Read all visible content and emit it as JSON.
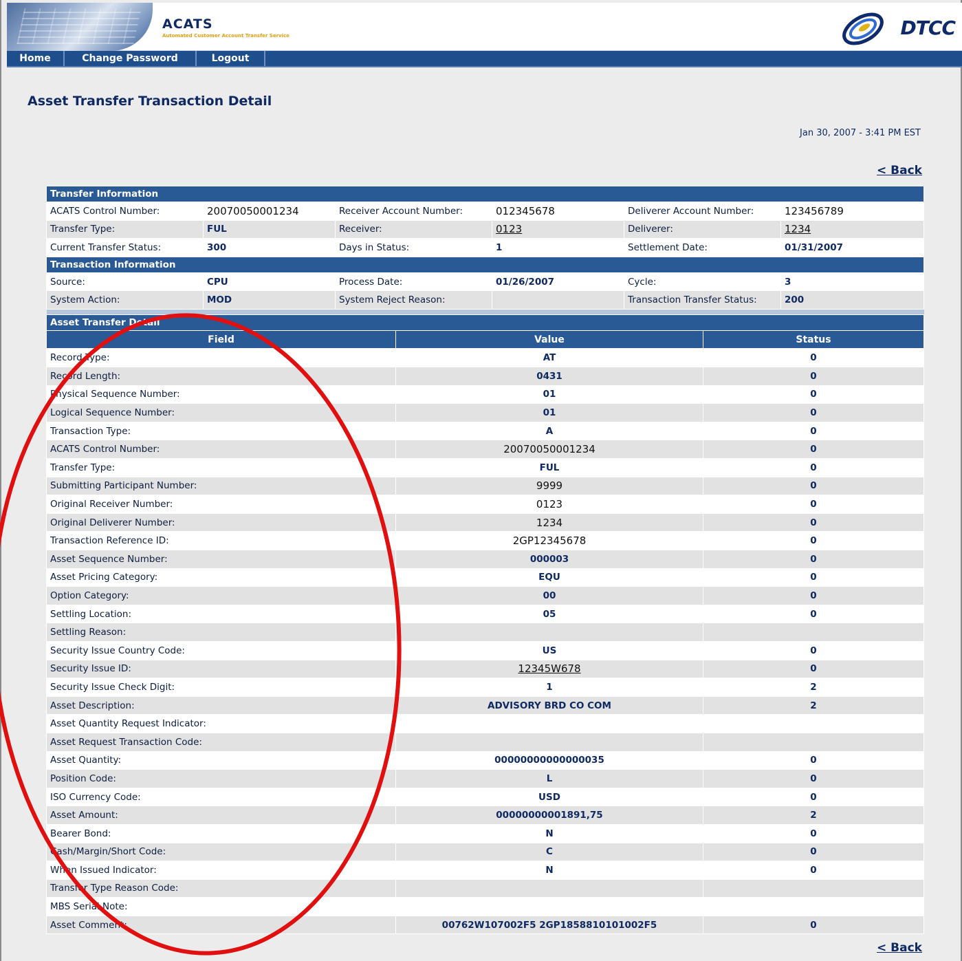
{
  "app": {
    "title": "ACATS",
    "subtitle": "Automated Customer Account Transfer Service",
    "brand": "DTCC"
  },
  "nav": {
    "home": "Home",
    "change_password": "Change Password",
    "logout": "Logout"
  },
  "page": {
    "title": "Asset Transfer Transaction Detail",
    "timestamp": "Jan 30, 2007 - 3:41 PM EST",
    "back_label": "< Back"
  },
  "transfer_info": {
    "heading": "Transfer Information",
    "rows": [
      [
        {
          "label": "ACATS Control Number:",
          "value": "20070050001234"
        },
        {
          "label": "Receiver Account Number:",
          "value": "012345678"
        },
        {
          "label": "Deliverer Account Number:",
          "value": "123456789"
        }
      ],
      [
        {
          "label": "Transfer Type:",
          "value": "FUL"
        },
        {
          "label": "Receiver:",
          "value": "0123"
        },
        {
          "label": "Deliverer:",
          "value": "1234"
        }
      ],
      [
        {
          "label": "Current Transfer Status:",
          "value": "300"
        },
        {
          "label": "Days in Status:",
          "value": "1"
        },
        {
          "label": "Settlement Date:",
          "value": "01/31/2007"
        }
      ]
    ]
  },
  "transaction_info": {
    "heading": "Transaction Information",
    "rows": [
      [
        {
          "label": "Source:",
          "value": "CPU"
        },
        {
          "label": "Process Date:",
          "value": "01/26/2007"
        },
        {
          "label": "Cycle:",
          "value": "3"
        }
      ],
      [
        {
          "label": "System Action:",
          "value": "MOD"
        },
        {
          "label": "System Reject Reason:",
          "value": ""
        },
        {
          "label": "Transaction Transfer Status:",
          "value": "200"
        }
      ]
    ]
  },
  "asset_detail": {
    "heading": "Asset Transfer Detail",
    "columns": [
      "Field",
      "Value",
      "Status"
    ],
    "rows": [
      {
        "field": "Record Type:",
        "value": "AT",
        "status": "0"
      },
      {
        "field": "Record Length:",
        "value": "0431",
        "status": "0"
      },
      {
        "field": "Physical Sequence Number:",
        "value": "01",
        "status": "0"
      },
      {
        "field": "Logical Sequence Number:",
        "value": "01",
        "status": "0"
      },
      {
        "field": "Transaction Type:",
        "value": "A",
        "status": "0"
      },
      {
        "field": "ACATS Control Number:",
        "value": "20070050001234",
        "status": "0"
      },
      {
        "field": "Transfer Type:",
        "value": "FUL",
        "status": "0"
      },
      {
        "field": "Submitting Participant Number:",
        "value": "9999",
        "status": "0"
      },
      {
        "field": "Original Receiver Number:",
        "value": "0123",
        "status": "0"
      },
      {
        "field": "Original Deliverer Number:",
        "value": "1234",
        "status": "0"
      },
      {
        "field": "Transaction Reference ID:",
        "value": "2GP12345678",
        "status": "0"
      },
      {
        "field": "Asset Sequence Number:",
        "value": "000003",
        "status": "0"
      },
      {
        "field": "Asset Pricing Category:",
        "value": "EQU",
        "status": "0"
      },
      {
        "field": "Option Category:",
        "value": "00",
        "status": "0"
      },
      {
        "field": "Settling Location:",
        "value": "05",
        "status": "0"
      },
      {
        "field": "Settling Reason:",
        "value": "",
        "status": ""
      },
      {
        "field": "Security Issue Country Code:",
        "value": "US",
        "status": "0"
      },
      {
        "field": "Security Issue ID:",
        "value": "12345W678",
        "status": "0"
      },
      {
        "field": "Security Issue Check Digit:",
        "value": "1",
        "status": "2"
      },
      {
        "field": "Asset Description:",
        "value": "ADVISORY BRD CO COM",
        "status": "2"
      },
      {
        "field": "Asset Quantity Request Indicator:",
        "value": "",
        "status": ""
      },
      {
        "field": "Asset Request Transaction Code:",
        "value": "",
        "status": ""
      },
      {
        "field": "Asset Quantity:",
        "value": "00000000000000035",
        "status": "0"
      },
      {
        "field": "Position Code:",
        "value": "L",
        "status": "0"
      },
      {
        "field": "ISO Currency Code:",
        "value": "USD",
        "status": "0"
      },
      {
        "field": "Asset Amount:",
        "value": "00000000001891,75",
        "status": "2"
      },
      {
        "field": "Bearer Bond:",
        "value": "N",
        "status": "0"
      },
      {
        "field": "Cash/Margin/Short Code:",
        "value": "C",
        "status": "0"
      },
      {
        "field": "When Issued Indicator:",
        "value": "N",
        "status": "0"
      },
      {
        "field": "Transfer Type Reason Code:",
        "value": "",
        "status": ""
      },
      {
        "field": "MBS Serial Note:",
        "value": "",
        "status": ""
      },
      {
        "field": "Asset Comment:",
        "value": "00762W107002F5 2GP1858810101002F5",
        "status": "0"
      }
    ]
  },
  "colors": {
    "header_blue": "#2a5a96",
    "nav_blue": "#1f4e8d",
    "title_navy": "#0f2a63",
    "annotation_red": "#e01010"
  }
}
